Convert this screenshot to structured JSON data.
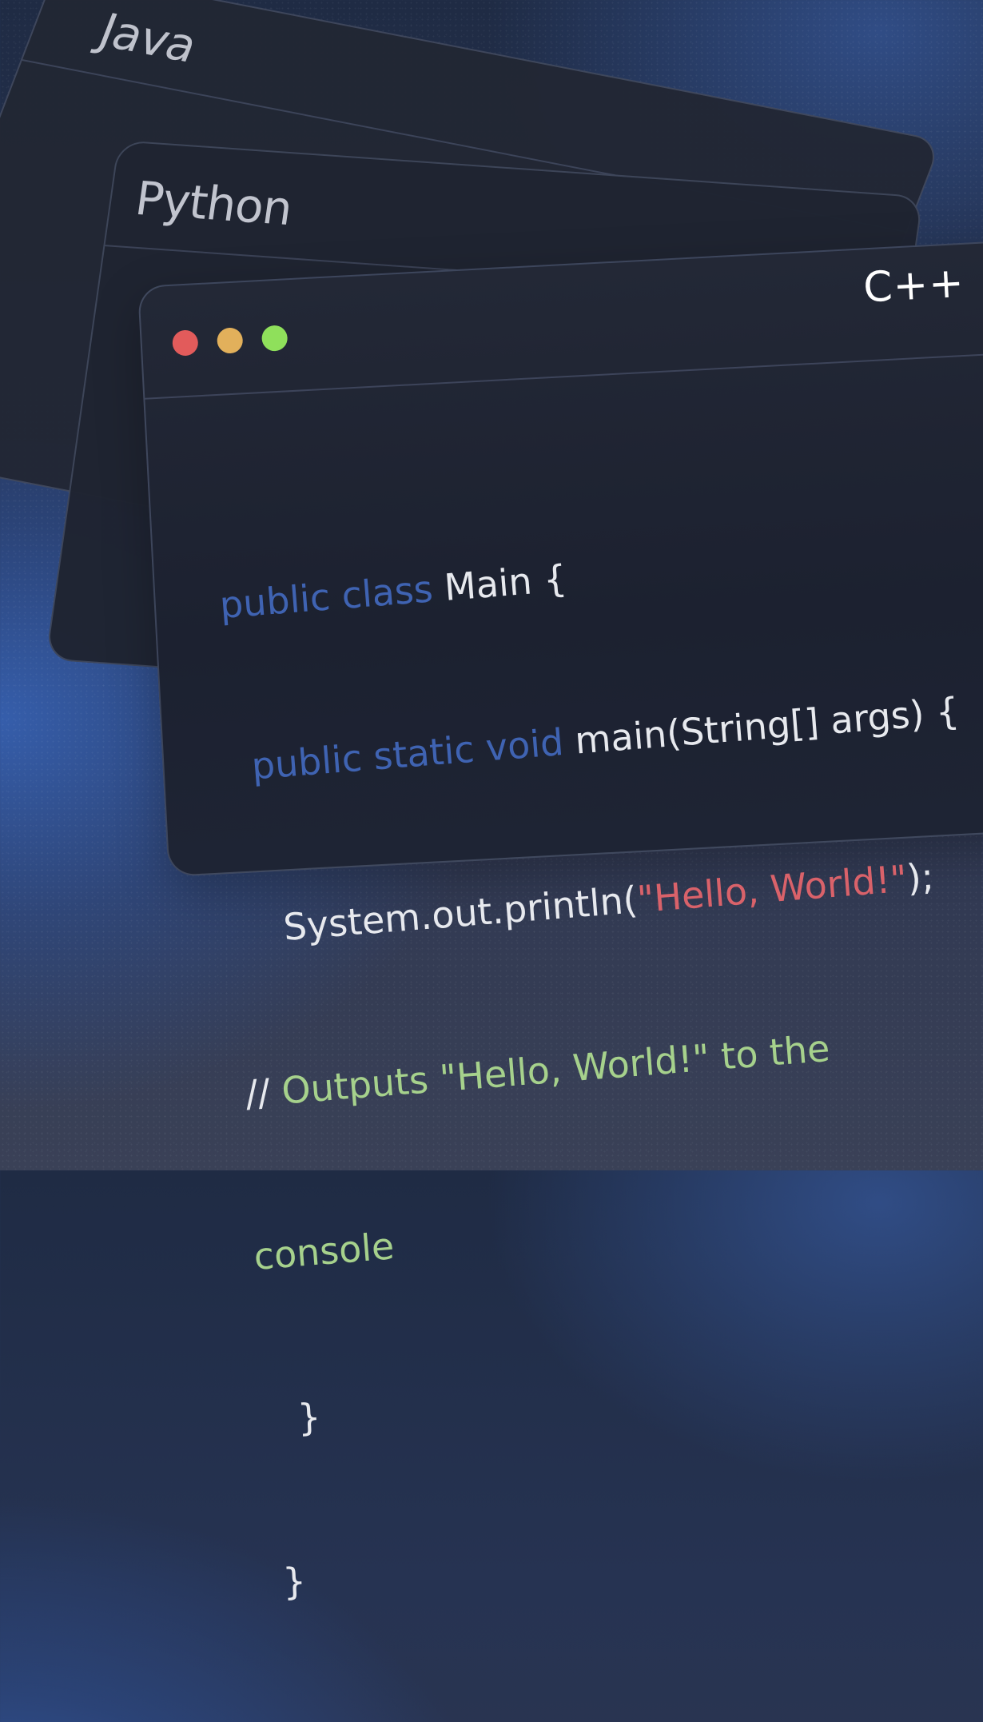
{
  "windows": {
    "java": {
      "title": "Java"
    },
    "python": {
      "title": "Python"
    },
    "cpp": {
      "title": "C++",
      "traffic_lights": {
        "close_color": "#e25b5b",
        "minimize_color": "#e2b05b",
        "maximize_color": "#8fe05b"
      }
    }
  },
  "code": {
    "line1": {
      "keyword": "public class",
      "rest": " Main {"
    },
    "line2": {
      "indent": "  ",
      "keyword": "public static void",
      "rest": " main(String[] args) {"
    },
    "line3": {
      "indent": "    ",
      "prefix": "System.out.println(",
      "string": "\"Hello, World!\"",
      "suffix": ");"
    },
    "line4": {
      "slashes": "//",
      "comment": " Outputs \"Hello, World!\" to the"
    },
    "line5": {
      "comment": "console"
    },
    "line6": {
      "text": "   }"
    },
    "line7": {
      "text": " }"
    }
  },
  "colors": {
    "keyword": "#3f63b2",
    "string": "#d9626a",
    "comment": "#a6d18c",
    "text": "#e7e9ee"
  }
}
